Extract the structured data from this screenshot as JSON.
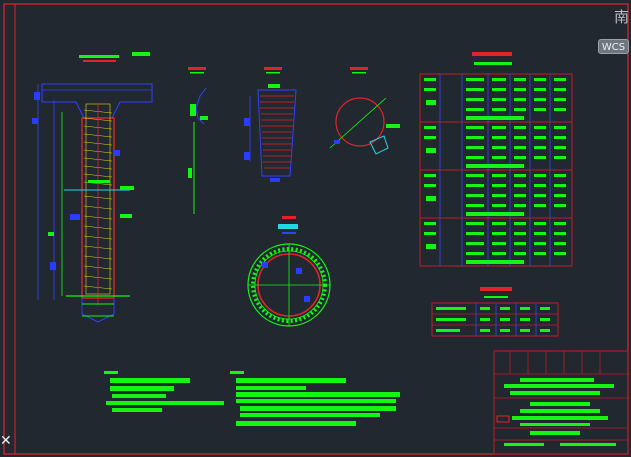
{
  "viewcube": {
    "direction_label": "南"
  },
  "ucs": {
    "label": "WCS"
  },
  "colors": {
    "background": "#212830",
    "frame": "#e0242a",
    "text_green": "#14f514",
    "dim_blue": "#2a3cff",
    "hatch_yellow": "#e8d21a",
    "cyan": "#27d6e6",
    "table_line": "#c21b24",
    "grid_blue": "#3340ff"
  },
  "cursor": {
    "icon": "crosshair-icon"
  }
}
